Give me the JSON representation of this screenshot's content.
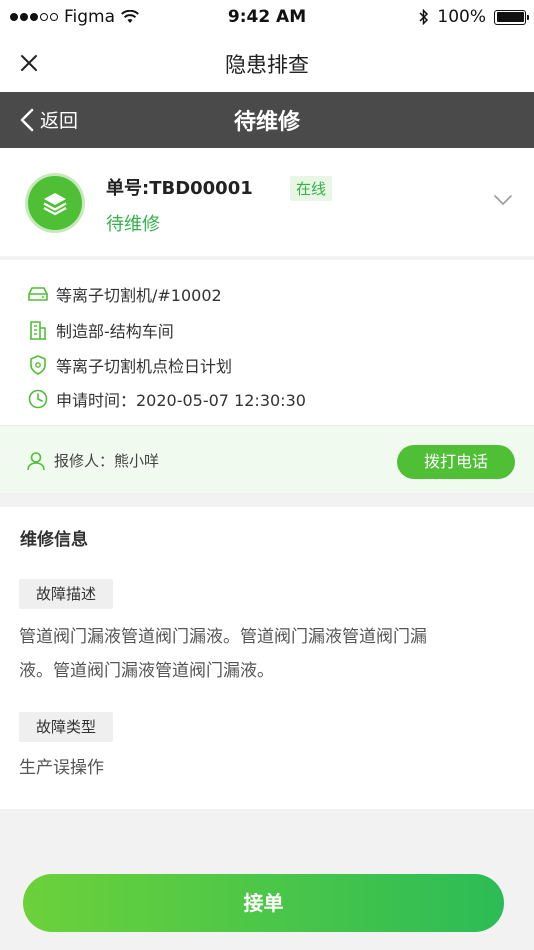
{
  "status_bar": {
    "carrier": "Figma",
    "time": "9:42 AM",
    "battery": "100%",
    "battery_level": 1.0
  },
  "outer_nav": {
    "title": "隐患排查",
    "close_icon": "close-icon"
  },
  "inner_header": {
    "back_label": "返回",
    "title": "待维修"
  },
  "order": {
    "number_label": "单号:TBD00001",
    "online_badge": "在线",
    "status": "待维修",
    "avatar_icon": "layers-icon"
  },
  "info": {
    "equipment": "等离子切割机/#10002",
    "department": "制造部-结构车间",
    "plan": "等离子切割机点检日计划",
    "apply_time": "申请时间：2020-05-07 12:30:30"
  },
  "reporter": {
    "label": "报修人：熊小咩",
    "call_button": "拨打电话"
  },
  "repair": {
    "heading": "维修信息",
    "fault_desc_tag": "故障描述",
    "fault_desc_line1": "管道阀门漏液管道阀门漏液。管道阀门漏液管道阀门漏",
    "fault_desc_line2": "液。管道阀门漏液管道阀门漏液。",
    "fault_type_tag": "故障类型",
    "fault_type": "生产误操作"
  },
  "footer": {
    "accept_button": "接单"
  },
  "colors": {
    "accent": "#4fbf35",
    "header_bg": "#4a4a4a",
    "text_green": "#34b24a"
  }
}
